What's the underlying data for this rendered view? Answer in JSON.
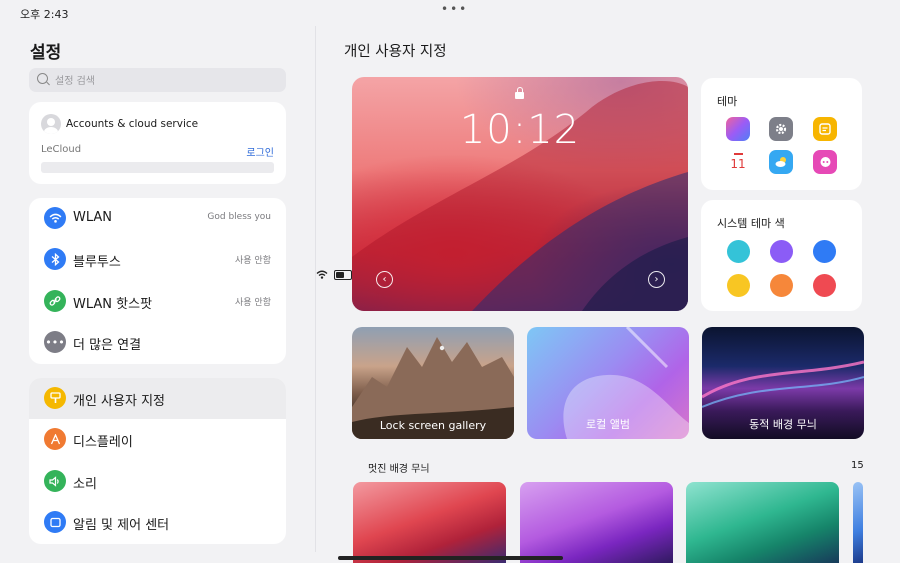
{
  "status_bar": {
    "time": "오후 2:43",
    "menu_dots": "•••"
  },
  "settings": {
    "title": "설정",
    "search_placeholder": "설정 검색",
    "account": {
      "title": "Accounts & cloud service",
      "service": "LeCloud",
      "login": "로그인"
    },
    "connections": [
      {
        "icon": "wifi-icon",
        "color": "#2f7bf5",
        "label": "WLAN",
        "value": "God bless you"
      },
      {
        "icon": "bluetooth-icon",
        "color": "#2f7bf5",
        "label": "블루투스",
        "value": "사용 안함"
      },
      {
        "icon": "hotspot-icon",
        "color": "#34b35a",
        "label": "WLAN 핫스팟",
        "value": "사용 안함"
      },
      {
        "icon": "more-icon",
        "color": "#7d7d86",
        "label": "더 많은 연결",
        "value": ""
      }
    ],
    "personal": [
      {
        "icon": "personalization-icon",
        "color": "#f5b800",
        "label": "개인 사용자 지정",
        "selected": true
      },
      {
        "icon": "display-icon",
        "color": "#f07a32",
        "label": "디스플레이"
      },
      {
        "icon": "sound-icon",
        "color": "#34b35a",
        "label": "소리"
      },
      {
        "icon": "notification-icon",
        "color": "#2f7bf5",
        "label": "알림 및 제어 센터"
      }
    ]
  },
  "content": {
    "title": "개인 사용자 지정",
    "lockscreen_preview": {
      "time": "10:12"
    },
    "theme": {
      "label": "테마",
      "icons": [
        "gallery-app-icon",
        "settings-app-icon",
        "notes-app-icon",
        "calendar-app-icon",
        "weather-app-icon",
        "assistant-app-icon"
      ],
      "calendar_day": "11"
    },
    "system_theme_color": {
      "label": "시스템 테마 색",
      "colors": [
        "#34c3d8",
        "#8b5cf6",
        "#2f7bf5",
        "#f8c623",
        "#f6873a",
        "#ef4a52"
      ]
    },
    "tiles": [
      {
        "label": "Lock screen gallery"
      },
      {
        "label": "로컬 앨범"
      },
      {
        "label": "동적 배경 무늬"
      }
    ],
    "wallpapers": {
      "label": "멋진 배경 무늬",
      "count": "15"
    }
  }
}
